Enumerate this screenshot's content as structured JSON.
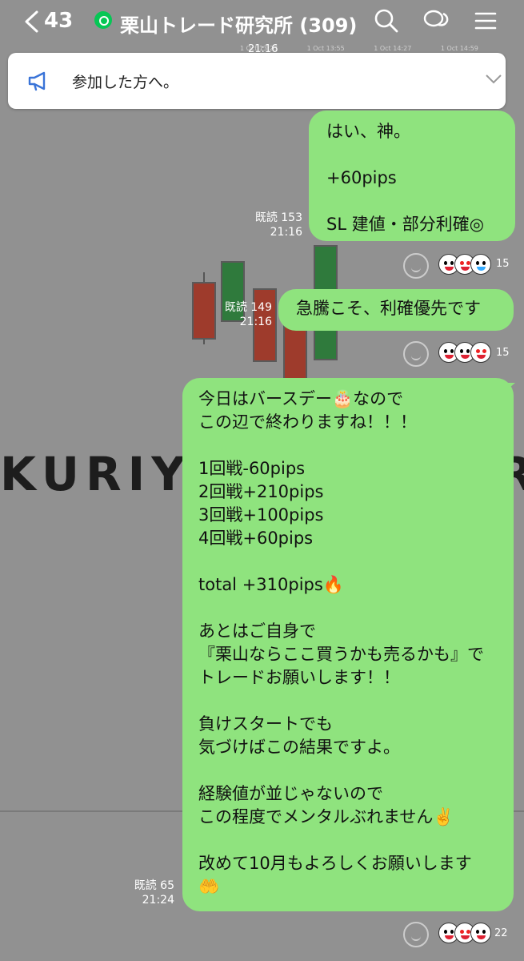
{
  "header": {
    "back_count": "43",
    "title": "栗山トレード研究所 (309)",
    "time_overlay": "21:16",
    "chart_ticks": [
      "1 Oct 13:23",
      "1 Oct 13:55",
      "1 Oct 14:27",
      "1 Oct 14:59"
    ]
  },
  "announcement": {
    "text": "参加した方へ。"
  },
  "wallpaper": {
    "logo_text": "KURIYAI",
    "logo_right": "R"
  },
  "messages": [
    {
      "text": "はい、神。\n\n+60pips\n\nSL 建値・部分利確◎",
      "read": "既読 153",
      "time": "21:16",
      "reaction_count": "15"
    },
    {
      "text": "急騰こそ、利確優先です",
      "read": "既読 149",
      "time": "21:16",
      "reaction_count": "15"
    },
    {
      "text": "今日はバースデー🎂なので\nこの辺で終わりますね！！！\n\n1回戦-60pips\n2回戦+210pips\n3回戦+100pips\n4回戦+60pips\n\ntotal +310pips🔥\n\nあとはご自身で\n『栗山ならここ買うかも売るかも』で\nトレードお願いします！！\n\n負けスタートでも\n気づけばこの結果ですよ。\n\n経験値が並じゃないので\nこの程度でメンタルぶれません✌️\n\n改めて10月もよろしくお願いします\n🤲",
      "read": "既読 65",
      "time": "21:24",
      "reaction_count": "22"
    }
  ],
  "colors": {
    "bubble": "#8fe37e",
    "accent": "#06c755"
  }
}
